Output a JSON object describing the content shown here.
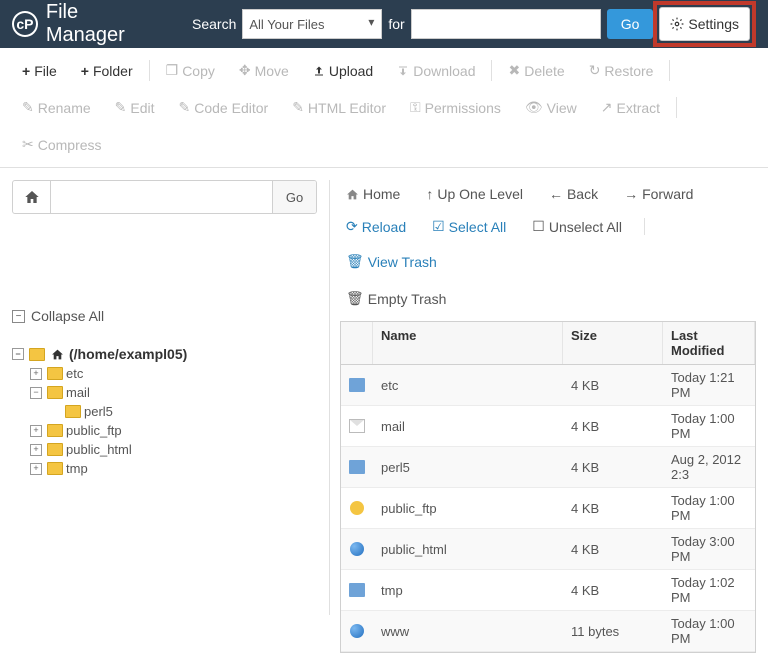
{
  "header": {
    "title": "File Manager",
    "search_label": "Search",
    "search_scope": "All Your Files",
    "for_label": "for",
    "search_value": "",
    "go_label": "Go",
    "settings_label": "Settings"
  },
  "toolbar": {
    "file": "File",
    "folder": "Folder",
    "copy": "Copy",
    "move": "Move",
    "upload": "Upload",
    "download": "Download",
    "delete": "Delete",
    "restore": "Restore",
    "rename": "Rename",
    "edit": "Edit",
    "code_editor": "Code Editor",
    "html_editor": "HTML Editor",
    "permissions": "Permissions",
    "view": "View",
    "extract": "Extract",
    "compress": "Compress"
  },
  "left": {
    "go_label": "Go",
    "path_value": "",
    "collapse_label": "Collapse All",
    "root_label": "(/home/exampl05)",
    "nodes": [
      {
        "label": "etc",
        "expand": "+"
      },
      {
        "label": "mail",
        "expand": "−",
        "children": [
          {
            "label": "perl5"
          }
        ]
      },
      {
        "label": "public_ftp",
        "expand": "+"
      },
      {
        "label": "public_html",
        "expand": "+"
      },
      {
        "label": "tmp",
        "expand": "+"
      }
    ]
  },
  "crumbs": {
    "home": "Home",
    "up": "Up One Level",
    "back": "Back",
    "forward": "Forward",
    "reload": "Reload",
    "select_all": "Select All",
    "unselect_all": "Unselect All",
    "view_trash": "View Trash",
    "empty_trash": "Empty Trash"
  },
  "grid": {
    "headers": {
      "name": "Name",
      "size": "Size",
      "modified": "Last Modified"
    },
    "rows": [
      {
        "icon": "folder",
        "name": "etc",
        "size": "4 KB",
        "modified": "Today 1:21 PM"
      },
      {
        "icon": "mail",
        "name": "mail",
        "size": "4 KB",
        "modified": "Today 1:00 PM"
      },
      {
        "icon": "folder",
        "name": "perl5",
        "size": "4 KB",
        "modified": "Aug 2, 2012 2:3"
      },
      {
        "icon": "ftp",
        "name": "public_ftp",
        "size": "4 KB",
        "modified": "Today 1:00 PM"
      },
      {
        "icon": "globe",
        "name": "public_html",
        "size": "4 KB",
        "modified": "Today 3:00 PM"
      },
      {
        "icon": "folder",
        "name": "tmp",
        "size": "4 KB",
        "modified": "Today 1:02 PM"
      },
      {
        "icon": "globe",
        "name": "www",
        "size": "11 bytes",
        "modified": "Today 1:00 PM"
      }
    ]
  }
}
